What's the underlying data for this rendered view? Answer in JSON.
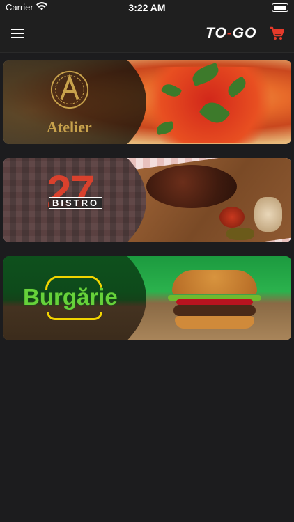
{
  "status_bar": {
    "carrier": "Carrier",
    "time": "3:22 AM",
    "icons": [
      "wifi-icon",
      "battery-icon"
    ]
  },
  "header": {
    "menu_icon": "hamburger-menu-icon",
    "logo_text_left": "TO",
    "logo_text_dash": "-",
    "logo_text_right": "GO",
    "cart_icon": "shopping-cart-icon",
    "colors": {
      "background": "#1f1f1f",
      "accent": "#e63a2a"
    }
  },
  "restaurants": [
    {
      "name": "Atelier",
      "logo_text": "Atelier"
    },
    {
      "name": "Bistro 27",
      "logo_number": "27",
      "logo_word": "BISTRO"
    },
    {
      "name": "Burgărie",
      "logo_text": "Burgărie"
    }
  ]
}
